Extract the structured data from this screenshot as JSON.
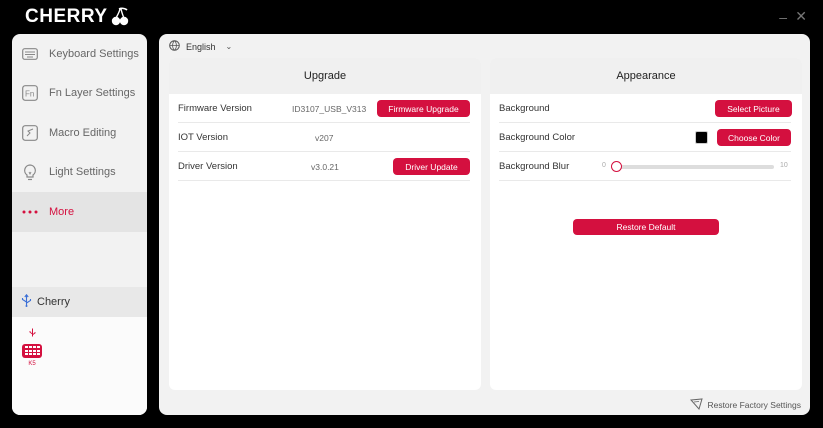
{
  "app": {
    "brand": "CHERRY"
  },
  "sidebar": {
    "items": [
      {
        "label": "Keyboard Settings",
        "icon": "keyboard-icon",
        "active": false
      },
      {
        "label": "Fn Layer Settings",
        "icon": "fn-icon",
        "active": false
      },
      {
        "label": "Macro Editing",
        "icon": "macro-icon",
        "active": false
      },
      {
        "label": "Light Settings",
        "icon": "lightbulb-icon",
        "active": false
      },
      {
        "label": "More",
        "icon": "more-dots-icon",
        "active": true
      }
    ],
    "device_group": {
      "label": "Cherry",
      "icon": "usb-icon"
    },
    "device": {
      "name": "K5",
      "icon": "keyboard-device-icon"
    }
  },
  "language": {
    "value": "English",
    "icon": "globe-icon"
  },
  "upgrade": {
    "title": "Upgrade",
    "rows": [
      {
        "label": "Firmware Version",
        "value": "ID3107_USB_V313",
        "button": "Firmware Upgrade"
      },
      {
        "label": "IOT Version",
        "value": "v207"
      },
      {
        "label": "Driver Version",
        "value": "v3.0.21",
        "button": "Driver Update"
      }
    ]
  },
  "appearance": {
    "title": "Appearance",
    "background": {
      "label": "Background",
      "button": "Select Picture"
    },
    "background_color": {
      "label": "Background Color",
      "button": "Choose Color",
      "color": "#000000"
    },
    "background_blur": {
      "label": "Background Blur",
      "min": "0",
      "max": "10",
      "value": 0
    },
    "restore_default": "Restore Default"
  },
  "footer": {
    "restore_factory": "Restore Factory Settings",
    "icon": "shield-icon"
  },
  "colors": {
    "accent": "#d4103f",
    "frame": "#000000",
    "panel": "#f2f2f2"
  }
}
